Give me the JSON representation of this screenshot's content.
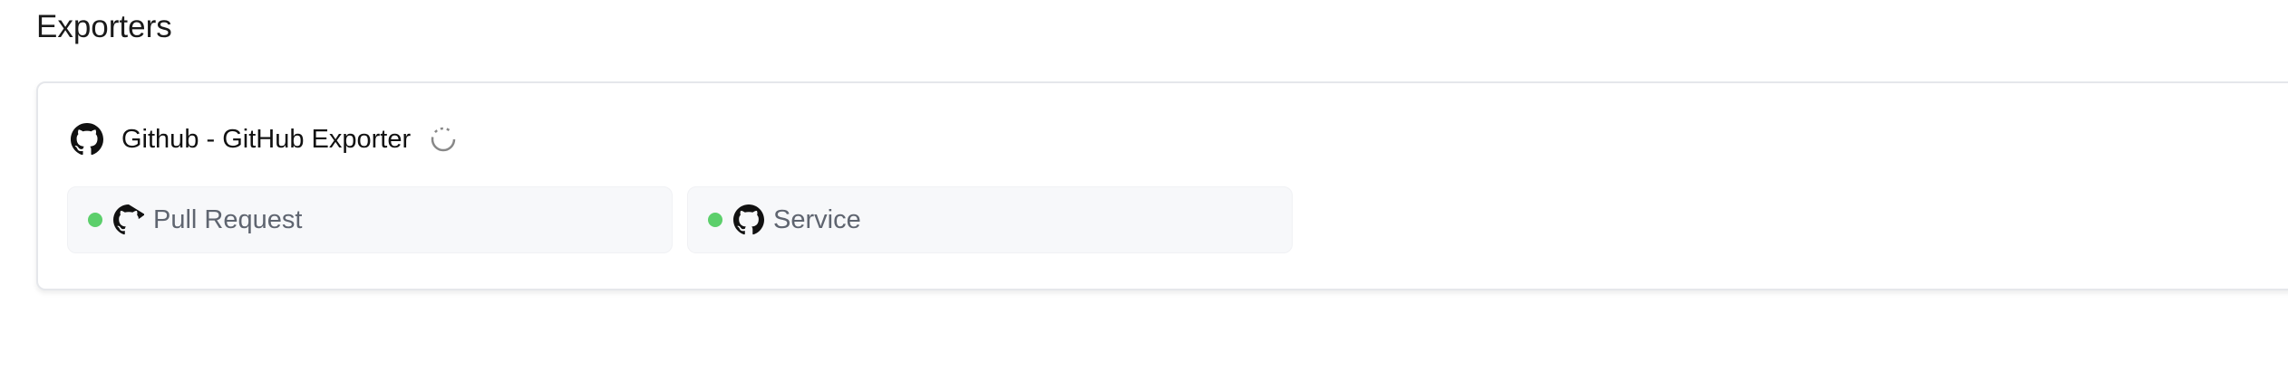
{
  "page": {
    "title": "Exporters"
  },
  "exporter": {
    "name": "Github - GitHub Exporter",
    "icon": "github-icon",
    "status_icon": "loading-spinner-icon",
    "kinds": [
      {
        "label": "Pull Request",
        "icon": "github-icon",
        "status_color": "#5ccf6b"
      },
      {
        "label": "Service",
        "icon": "github-icon",
        "status_color": "#5ccf6b"
      }
    ]
  },
  "colors": {
    "status_ok": "#5ccf6b",
    "chip_bg": "#f7f8fa",
    "border": "#e5e7eb"
  }
}
